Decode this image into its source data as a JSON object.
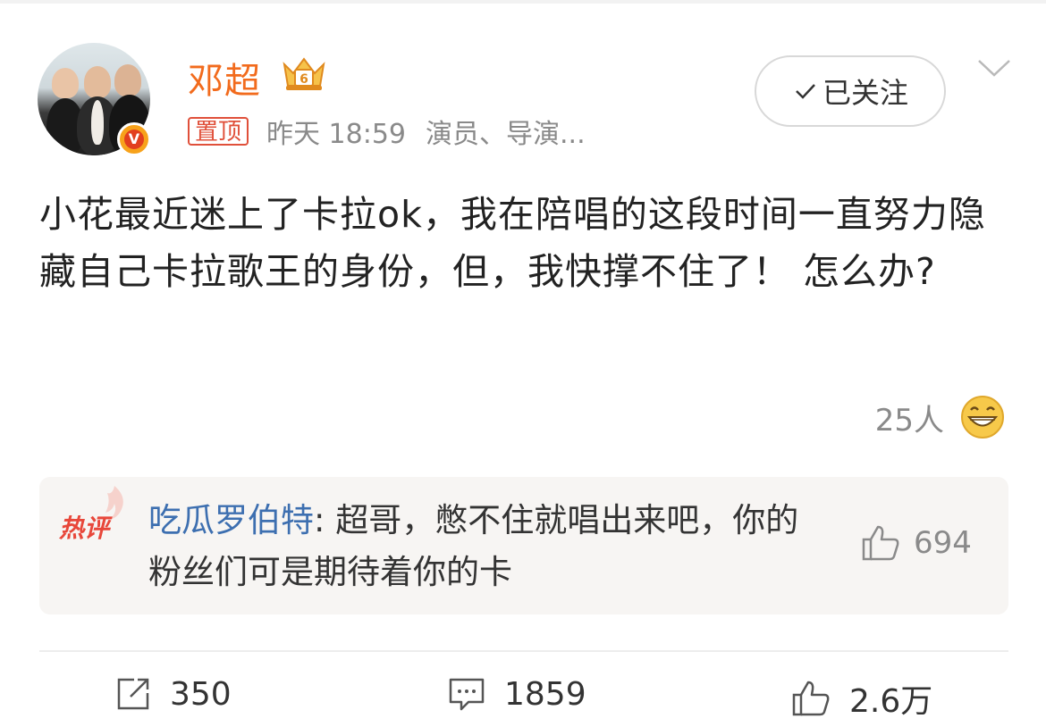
{
  "post": {
    "author": "邓超",
    "pinned_label": "置顶",
    "time": "昨天 18:59",
    "source": "演员、导演...",
    "follow_label": "已关注",
    "text": "小花最近迷上了卡拉ok，我在陪唱的这段时间一直努力隐藏自己卡拉歌王的身份，但，我快撑不住了！ 怎么办?",
    "reaction_count": "25人"
  },
  "hot_comment": {
    "label": "热评",
    "author": "吃瓜罗伯特",
    "separator": ": ",
    "text": "超哥，憋不住就唱出来吧，你的粉丝们可是期待着你的卡",
    "likes": "694"
  },
  "actions": {
    "share_count": "350",
    "comment_count": "1859",
    "like_count": "2.6万"
  },
  "icons": [
    "crown-icon",
    "verified-icon",
    "check-icon",
    "chevron-down-icon",
    "grin-icon",
    "flame-icon",
    "thumbs-up-icon",
    "share-icon",
    "comment-icon"
  ],
  "colors": {
    "author_name": "#f26b1d",
    "pinned": "#e0503a",
    "comment_author": "#3d6fb0",
    "hot_label": "#e8473a"
  }
}
